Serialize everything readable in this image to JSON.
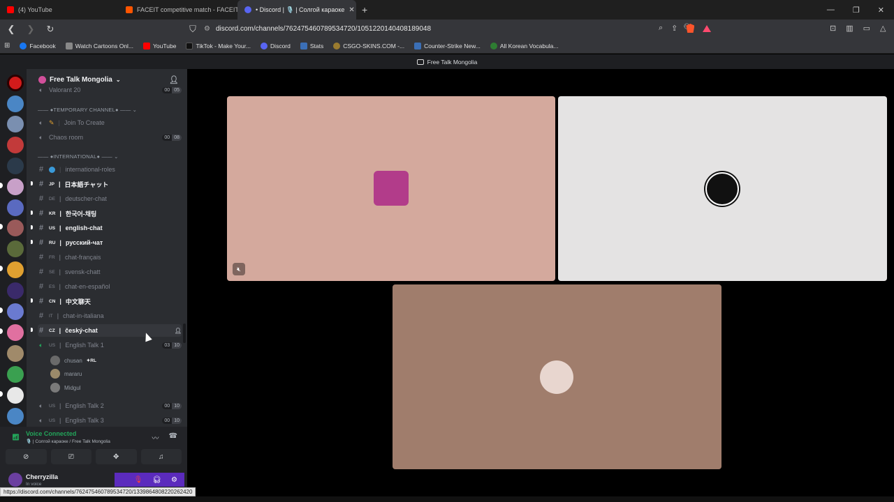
{
  "browser": {
    "tabs": [
      {
        "label": "(4) YouTube",
        "color": "#ff0000"
      },
      {
        "label": "FACEIT competitive match - FACEIT.c",
        "color": "#ff5500"
      },
      {
        "label": "• Discord | 🎙️ | Солгой караоке",
        "color": "#5865f2"
      }
    ],
    "url": "discord.com/channels/762475460789534720/1051220140408189048",
    "bookmarks": [
      {
        "label": "Facebook",
        "color": "#1877f2"
      },
      {
        "label": "Watch Cartoons Onl...",
        "color": "#888888"
      },
      {
        "label": "YouTube",
        "color": "#ff0000"
      },
      {
        "label": "TikTok - Make Your...",
        "color": "#111111"
      },
      {
        "label": "Discord",
        "color": "#5865f2"
      },
      {
        "label": "Stats",
        "color": "#3b6fb6"
      },
      {
        "label": "CSGO-SKINS.COM -...",
        "color": "#9a7b2f"
      },
      {
        "label": "Counter-Strike New...",
        "color": "#3b6fb6"
      },
      {
        "label": "All Korean Vocabula...",
        "color": "#2e7d32"
      }
    ]
  },
  "discord": {
    "window_title": "Free Talk Mongolia",
    "server_name": "Free Talk Mongolia",
    "channels": {
      "partial_top": "Valorant 20",
      "partial_top_counts": [
        "00",
        "05"
      ],
      "cat_temp": "●TEMPORARY CHANNEL●",
      "join_create": "Join To Create",
      "chaos_room": "Chaos room",
      "chaos_counts": [
        "00",
        "08"
      ],
      "cat_intl": "●INTERNATIONAL●",
      "intl_roles": "international-roles",
      "text": [
        {
          "cc": "JP",
          "label": "日本語チャット",
          "bold": true
        },
        {
          "cc": "DE",
          "label": "deutscher-chat",
          "bold": false
        },
        {
          "cc": "KR",
          "label": "한국어-채팅",
          "bold": true
        },
        {
          "cc": "US",
          "label": "english-chat",
          "bold": true
        },
        {
          "cc": "RU",
          "label": "русский-чат",
          "bold": true
        },
        {
          "cc": "FR",
          "label": "chat-français",
          "bold": false
        },
        {
          "cc": "SE",
          "label": "svensk-chatt",
          "bold": false
        },
        {
          "cc": "ES",
          "label": "chat-en-español",
          "bold": false
        },
        {
          "cc": "CN",
          "label": "中文聊天",
          "bold": true
        },
        {
          "cc": "IT",
          "label": "chat-in-italiana",
          "bold": false
        },
        {
          "cc": "CZ",
          "label": "český-chat",
          "bold": true
        }
      ],
      "voice1": {
        "cc": "US",
        "label": "English Talk 1",
        "counts": [
          "03",
          "10"
        ]
      },
      "members": [
        {
          "name": "chusan",
          "tag": "RL",
          "color": "#6a6a6a"
        },
        {
          "name": "mararu",
          "color": "#9b8a6a"
        },
        {
          "name": "Midgul",
          "color": "#7a7a7a"
        }
      ],
      "voice2": {
        "cc": "US",
        "label": "English Talk 2",
        "counts": [
          "00",
          "10"
        ]
      },
      "voice3": {
        "cc": "US",
        "label": "English Talk 3",
        "counts": [
          "00",
          "10"
        ]
      }
    },
    "voice_panel": {
      "status": "Voice Connected",
      "sub": "🎙️ | Солгой караоке / Free Talk Mongolia"
    },
    "user": {
      "name": "Cherryzilla",
      "status": "In voice"
    },
    "hover_url": "https://discord.com/channels/762475460789534720/1339864808220262420",
    "tiles": [
      {
        "bg": "#d4a99d",
        "avatar": "#b23c8a"
      },
      {
        "bg": "#e4e3e3",
        "avatar": "#111111"
      },
      {
        "bg": "#a07d6c",
        "avatar": "#e8d6cf"
      }
    ]
  }
}
